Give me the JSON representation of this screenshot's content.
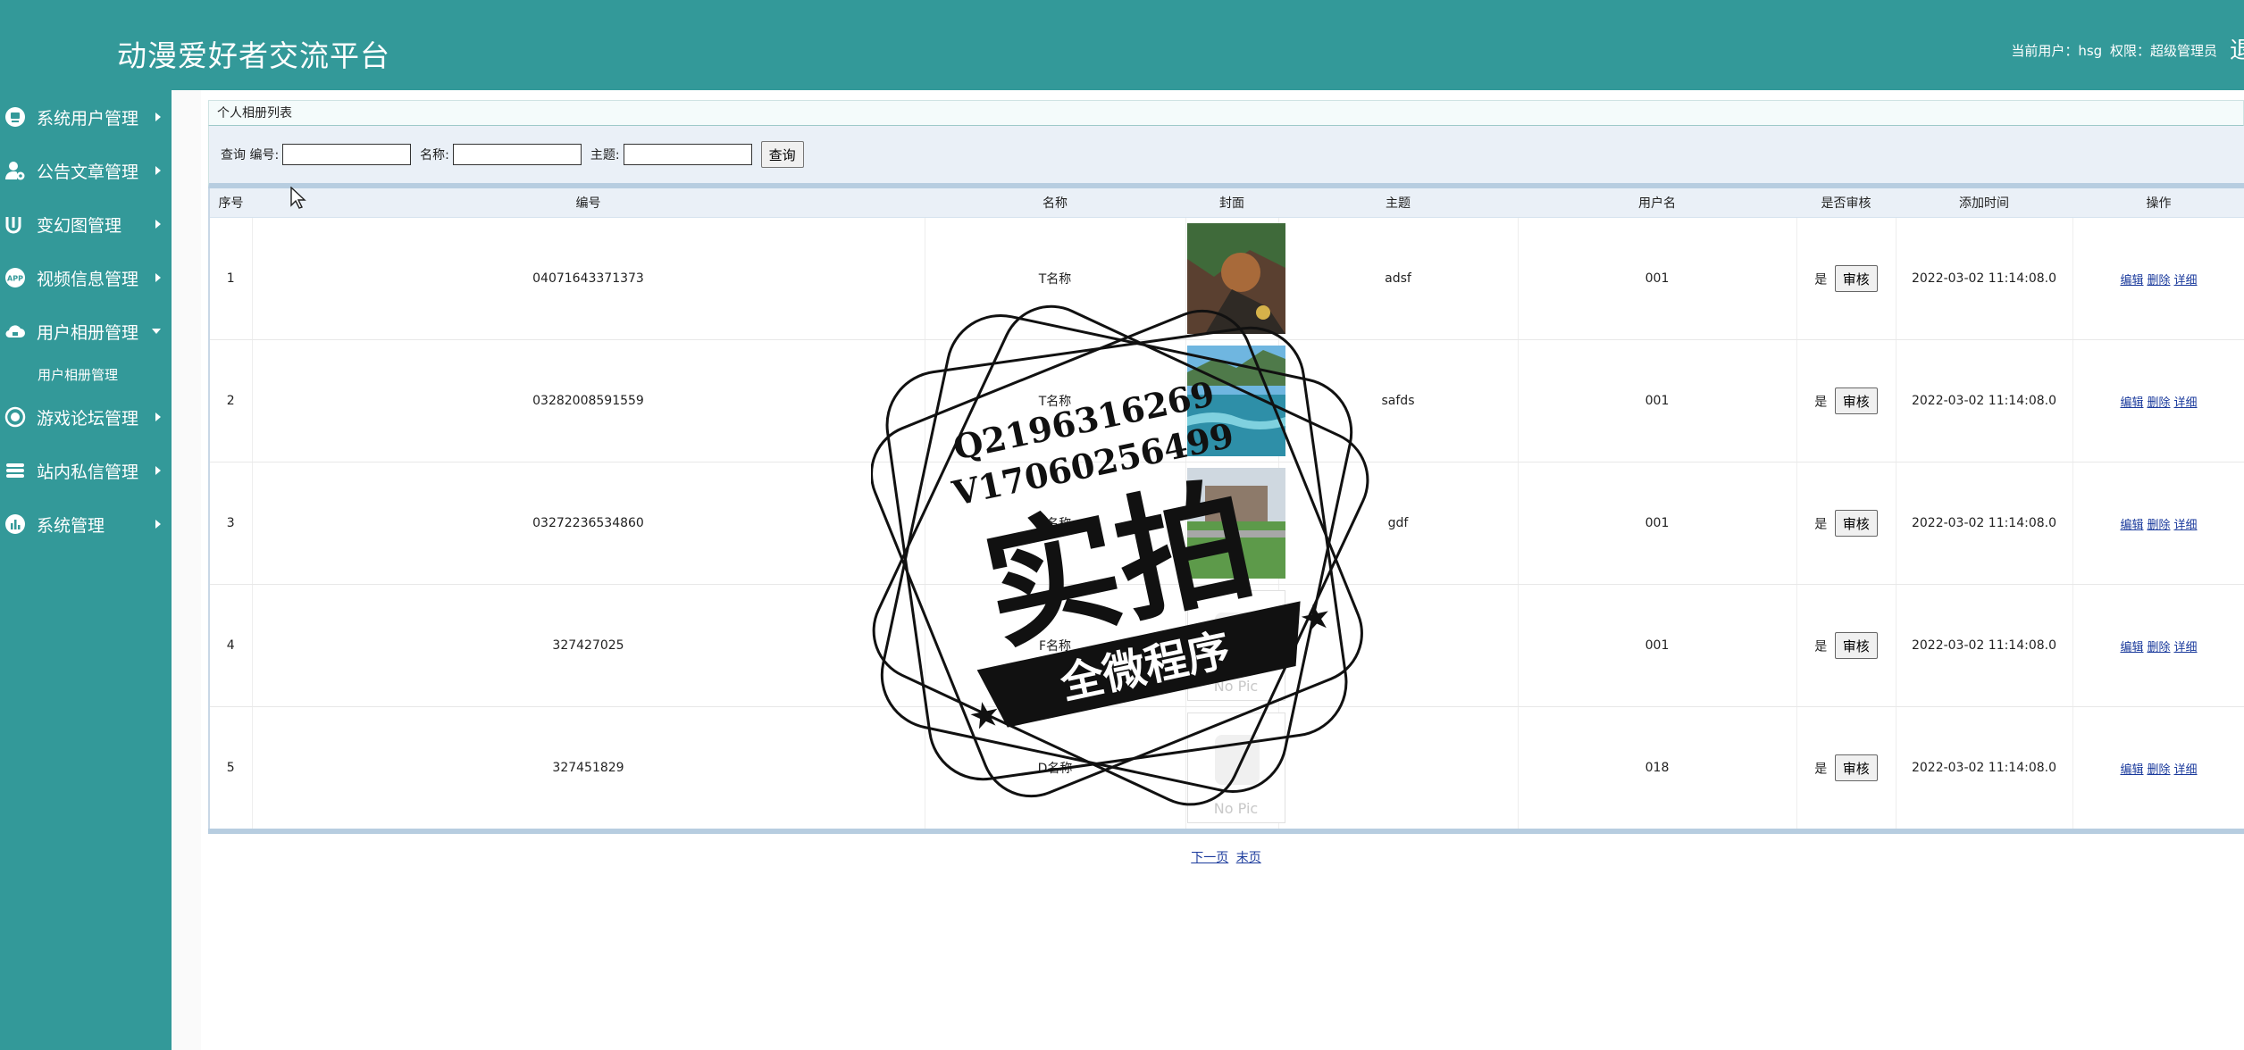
{
  "header": {
    "app_title": "动漫爱好者交流平台",
    "current_user_label": "当前用户：hsg",
    "permission_label": "权限：超级管理员",
    "logout_partial": "退"
  },
  "sidebar": {
    "items": [
      {
        "label": "系统用户管理",
        "icon": "user-badge-icon"
      },
      {
        "label": "公告文章管理",
        "icon": "user-gear-icon"
      },
      {
        "label": "变幻图管理",
        "icon": "carousel-icon"
      },
      {
        "label": "视频信息管理",
        "icon": "app-icon"
      },
      {
        "label": "用户相册管理",
        "icon": "cloud-icon",
        "expanded": true
      },
      {
        "label": "游戏论坛管理",
        "icon": "target-icon"
      },
      {
        "label": "站内私信管理",
        "icon": "database-icon"
      },
      {
        "label": "系统管理",
        "icon": "chart-icon"
      }
    ],
    "submenu": {
      "label": "用户相册管理"
    }
  },
  "main": {
    "panel_title": "个人相册列表",
    "search": {
      "prefix": "查询",
      "field1_label": "编号:",
      "field2_label": "名称:",
      "field3_label": "主题:",
      "field1_value": "",
      "field2_value": "",
      "field3_value": "",
      "button": "查询"
    },
    "table": {
      "headers": [
        "序号",
        "编号",
        "名称",
        "封面",
        "主题",
        "用户名",
        "是否审核",
        "添加时间",
        "操作"
      ],
      "rows": [
        {
          "index": "1",
          "code": "04071643371373",
          "name": "T名称",
          "cover": "image-1",
          "topic": "adsf",
          "user": "001",
          "audited": "是",
          "audit_btn": "审核",
          "time": "2022-03-02 11:14:08.0"
        },
        {
          "index": "2",
          "code": "03282008591559",
          "name": "T名称",
          "cover": "image-2",
          "topic": "safds",
          "user": "001",
          "audited": "是",
          "audit_btn": "审核",
          "time": "2022-03-02 11:14:08.0"
        },
        {
          "index": "3",
          "code": "03272236534860",
          "name": "T名称",
          "cover": "image-3",
          "topic": "gdf",
          "user": "001",
          "audited": "是",
          "audit_btn": "审核",
          "time": "2022-03-02 11:14:08.0"
        },
        {
          "index": "4",
          "code": "327427025",
          "name": "F名称",
          "cover": "no-pic",
          "topic": "",
          "user": "001",
          "audited": "是",
          "audit_btn": "审核",
          "time": "2022-03-02 11:14:08.0"
        },
        {
          "index": "5",
          "code": "327451829",
          "name": "D名称",
          "cover": "no-pic",
          "topic": "",
          "user": "018",
          "audited": "是",
          "audit_btn": "审核",
          "time": "2022-03-02 11:14:08.0"
        }
      ],
      "ops": {
        "edit": "编辑",
        "delete": "删除",
        "detail": "详细"
      },
      "no_pic_label": "No Pic"
    },
    "pager": {
      "next": "下一页",
      "last": "末页"
    }
  },
  "watermark": {
    "line1": "Q2196316269",
    "line2": "V17060256499",
    "main_text": "实拍",
    "banner": "全微程序"
  },
  "colors": {
    "teal": "#339999",
    "link": "#1a3a9c"
  }
}
